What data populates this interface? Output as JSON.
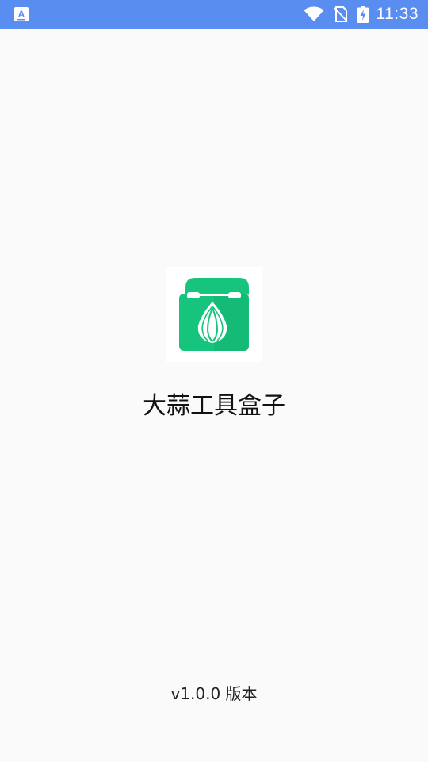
{
  "status_bar": {
    "time": "11:33",
    "left_icon": "keyboard-a-icon",
    "icons": [
      "wifi-icon",
      "no-sim-icon",
      "battery-charging-icon"
    ],
    "background_color": "#5a8df0"
  },
  "app": {
    "title": "大蒜工具盒子",
    "version": "v1.0.0 版本",
    "logo_icon": "toolbox-garlic-icon",
    "accent_color": "#16c47d"
  }
}
